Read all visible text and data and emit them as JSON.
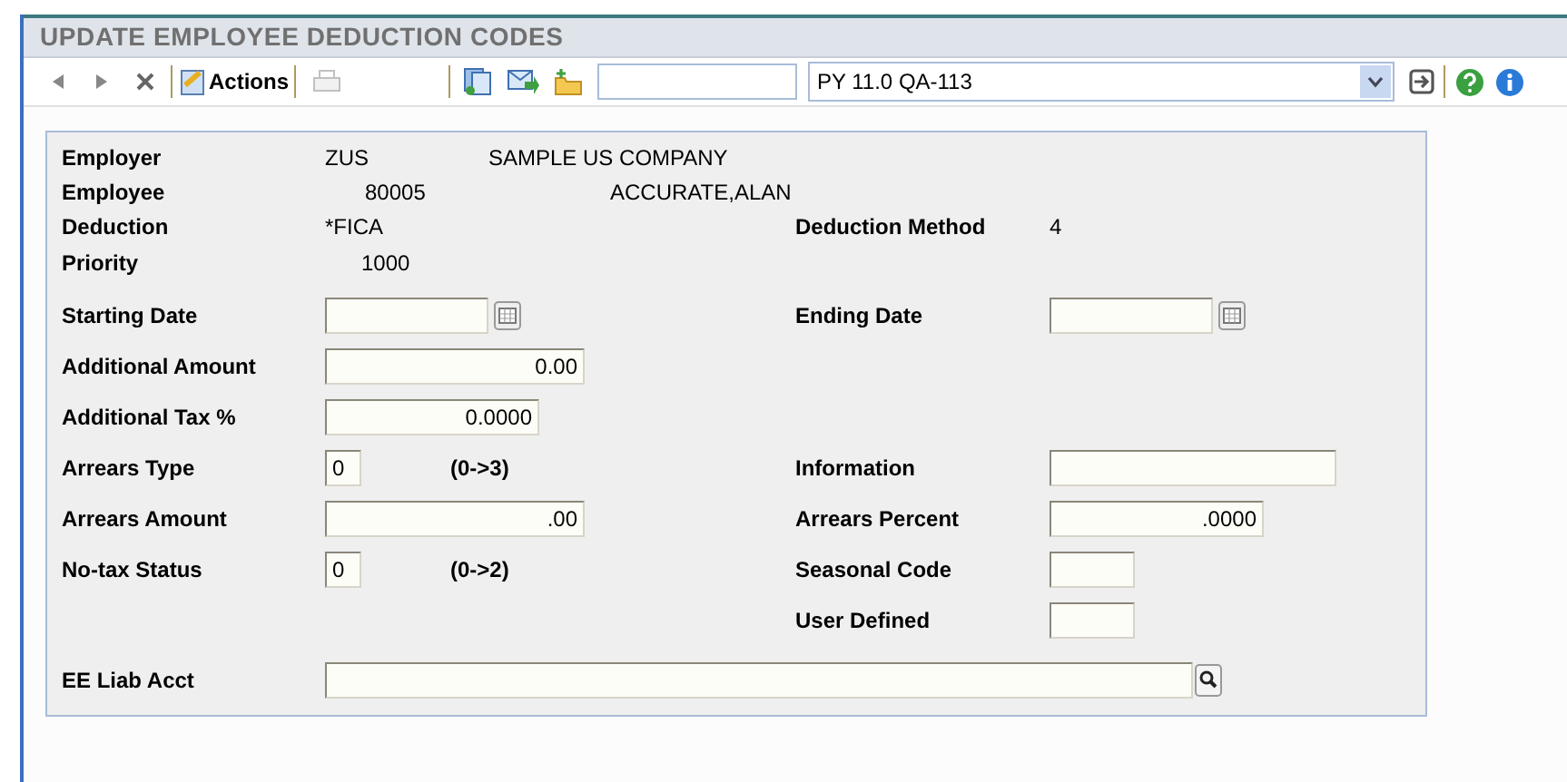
{
  "window": {
    "title": "UPDATE EMPLOYEE DEDUCTION CODES"
  },
  "toolbar": {
    "actions_label": "Actions",
    "print_disabled": true,
    "product": {
      "value": "PY 11.0 QA-113"
    }
  },
  "employer": {
    "label": "Employer",
    "code": "ZUS",
    "name": "SAMPLE US COMPANY"
  },
  "employee": {
    "label": "Employee",
    "number": "80005",
    "name": "ACCURATE,ALAN"
  },
  "deduction": {
    "label": "Deduction",
    "value": "*FICA"
  },
  "deduction_method": {
    "label": "Deduction Method",
    "value": "4"
  },
  "priority": {
    "label": "Priority",
    "value": "1000"
  },
  "rows": [
    {
      "left": {
        "kind": "date",
        "label": "Starting Date"
      },
      "right": {
        "kind": "date",
        "label": "Ending Date"
      }
    },
    {
      "left": {
        "kind": "amount",
        "label": "Additional Amount",
        "value": "0.00"
      }
    },
    {
      "left": {
        "kind": "rate",
        "label": "Additional Tax %",
        "value": "0.0000"
      }
    },
    {
      "left": {
        "kind": "code",
        "label": "Arrears Type",
        "value": "0",
        "range": "(0->3)"
      },
      "right": {
        "kind": "text",
        "label": "Information"
      }
    },
    {
      "left": {
        "kind": "amount",
        "label": "Arrears Amount",
        "value": ".00"
      },
      "right": {
        "kind": "rate",
        "label": "Arrears Percent",
        "value": ".0000"
      }
    },
    {
      "left": {
        "kind": "code",
        "label": "No-tax Status",
        "value": "0",
        "range": "(0->2)"
      },
      "right": {
        "kind": "short",
        "label": "Seasonal Code"
      }
    },
    {
      "right": {
        "kind": "short",
        "label": "User Defined"
      }
    },
    {
      "left": {
        "kind": "lookup",
        "label": "EE Liab Acct"
      }
    }
  ]
}
